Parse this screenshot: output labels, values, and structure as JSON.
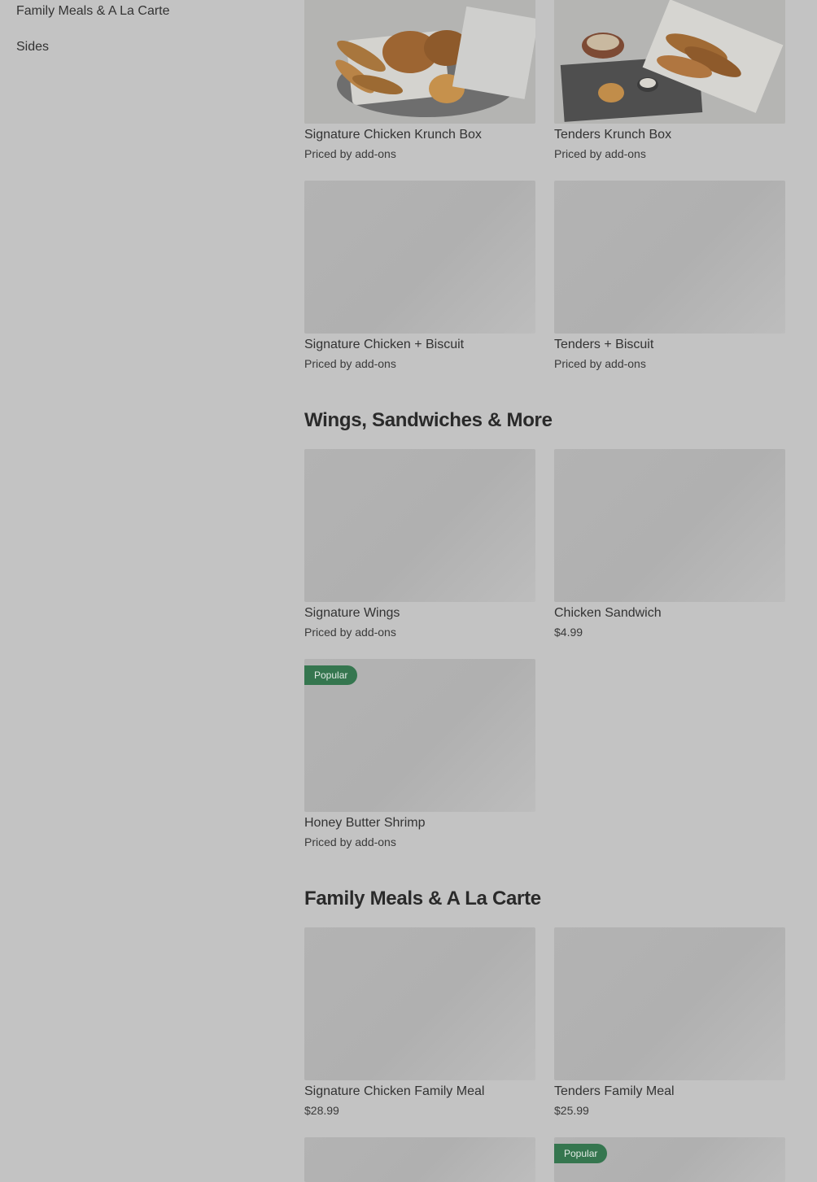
{
  "sidebar": {
    "items": [
      {
        "label": "Family Meals & A La Carte"
      },
      {
        "label": "Sides"
      }
    ]
  },
  "cards_top": [
    {
      "name": "Signature Chicken Krunch Box",
      "price": "Priced by add-ons",
      "image": "chicken-krunch-box-photo"
    },
    {
      "name": "Tenders Krunch Box",
      "price": "Priced by add-ons",
      "image": "tenders-krunch-box-photo"
    },
    {
      "name": "Signature Chicken + Biscuit",
      "price": "Priced by add-ons"
    },
    {
      "name": "Tenders + Biscuit",
      "price": "Priced by add-ons"
    }
  ],
  "sections": [
    {
      "title": "Wings, Sandwiches & More",
      "items": [
        {
          "name": "Signature Wings",
          "price": "Priced by add-ons"
        },
        {
          "name": "Chicken Sandwich",
          "price": "$4.99"
        },
        {
          "name": "Honey Butter Shrimp",
          "price": "Priced by add-ons",
          "badge": "Popular"
        }
      ]
    },
    {
      "title": "Family Meals & A La Carte",
      "items": [
        {
          "name": "Signature Chicken Family Meal",
          "price": "$28.99"
        },
        {
          "name": "Tenders Family Meal",
          "price": "$25.99"
        },
        {
          "name": "",
          "price": ""
        },
        {
          "name": "",
          "price": "",
          "badge": "Popular"
        }
      ]
    }
  ],
  "colors": {
    "overlay_background": "#c3c3c3",
    "badge_green": "#35764f"
  }
}
